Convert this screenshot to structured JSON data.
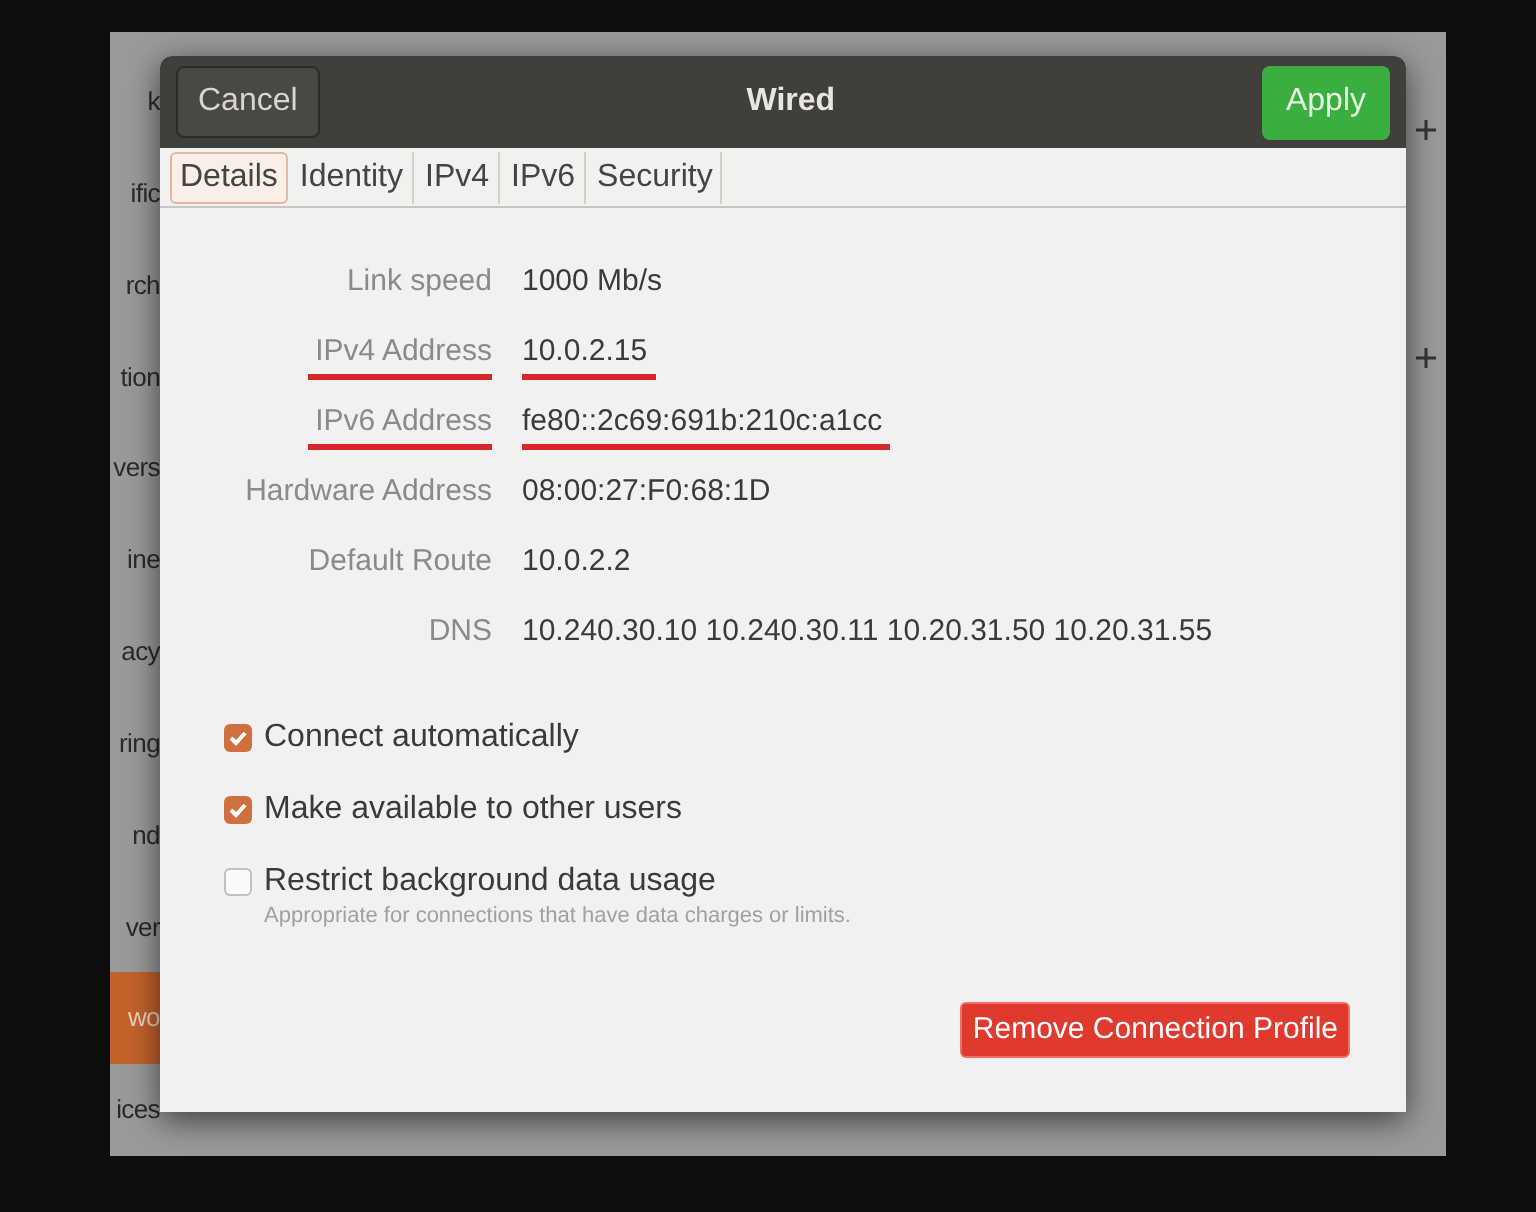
{
  "sidebar": {
    "items": [
      {
        "label": "k",
        "selected": false
      },
      {
        "label": "ific",
        "selected": false
      },
      {
        "label": "rch",
        "selected": false
      },
      {
        "label": "tion",
        "selected": false
      },
      {
        "label": "vers",
        "selected": false
      },
      {
        "label": "ine",
        "selected": false
      },
      {
        "label": "acy",
        "selected": false
      },
      {
        "label": "ring",
        "selected": false
      },
      {
        "label": "nd",
        "selected": false
      },
      {
        "label": "ver",
        "selected": false
      },
      {
        "label": "wo",
        "selected": true
      },
      {
        "label": "ices",
        "selected": false
      }
    ]
  },
  "dialog": {
    "title": "Wired",
    "cancel": "Cancel",
    "apply": "Apply",
    "tabs": [
      {
        "label": "Details",
        "selected": true
      },
      {
        "label": "Identity",
        "selected": false
      },
      {
        "label": "IPv4",
        "selected": false
      },
      {
        "label": "IPv6",
        "selected": false
      },
      {
        "label": "Security",
        "selected": false
      }
    ],
    "details": [
      {
        "label": "Link speed",
        "value": "1000 Mb/s",
        "underlined": false
      },
      {
        "label": "IPv4 Address",
        "value": "10.0.2.15",
        "underlined": true
      },
      {
        "label": "IPv6 Address",
        "value": "fe80::2c69:691b:210c:a1cc",
        "underlined": true
      },
      {
        "label": "Hardware Address",
        "value": "08:00:27:F0:68:1D",
        "underlined": false
      },
      {
        "label": "Default Route",
        "value": "10.0.2.2",
        "underlined": false
      },
      {
        "label": "DNS",
        "value": "10.240.30.10 10.240.30.11 10.20.31.50 10.20.31.55",
        "underlined": false
      }
    ],
    "options": [
      {
        "label": "Connect automatically",
        "checked": true
      },
      {
        "label": "Make available to other users",
        "checked": true
      },
      {
        "label": "Restrict background data usage",
        "hint": "Appropriate for connections that have data charges or limits.",
        "checked": false
      }
    ],
    "remove_button": "Remove Connection Profile"
  }
}
